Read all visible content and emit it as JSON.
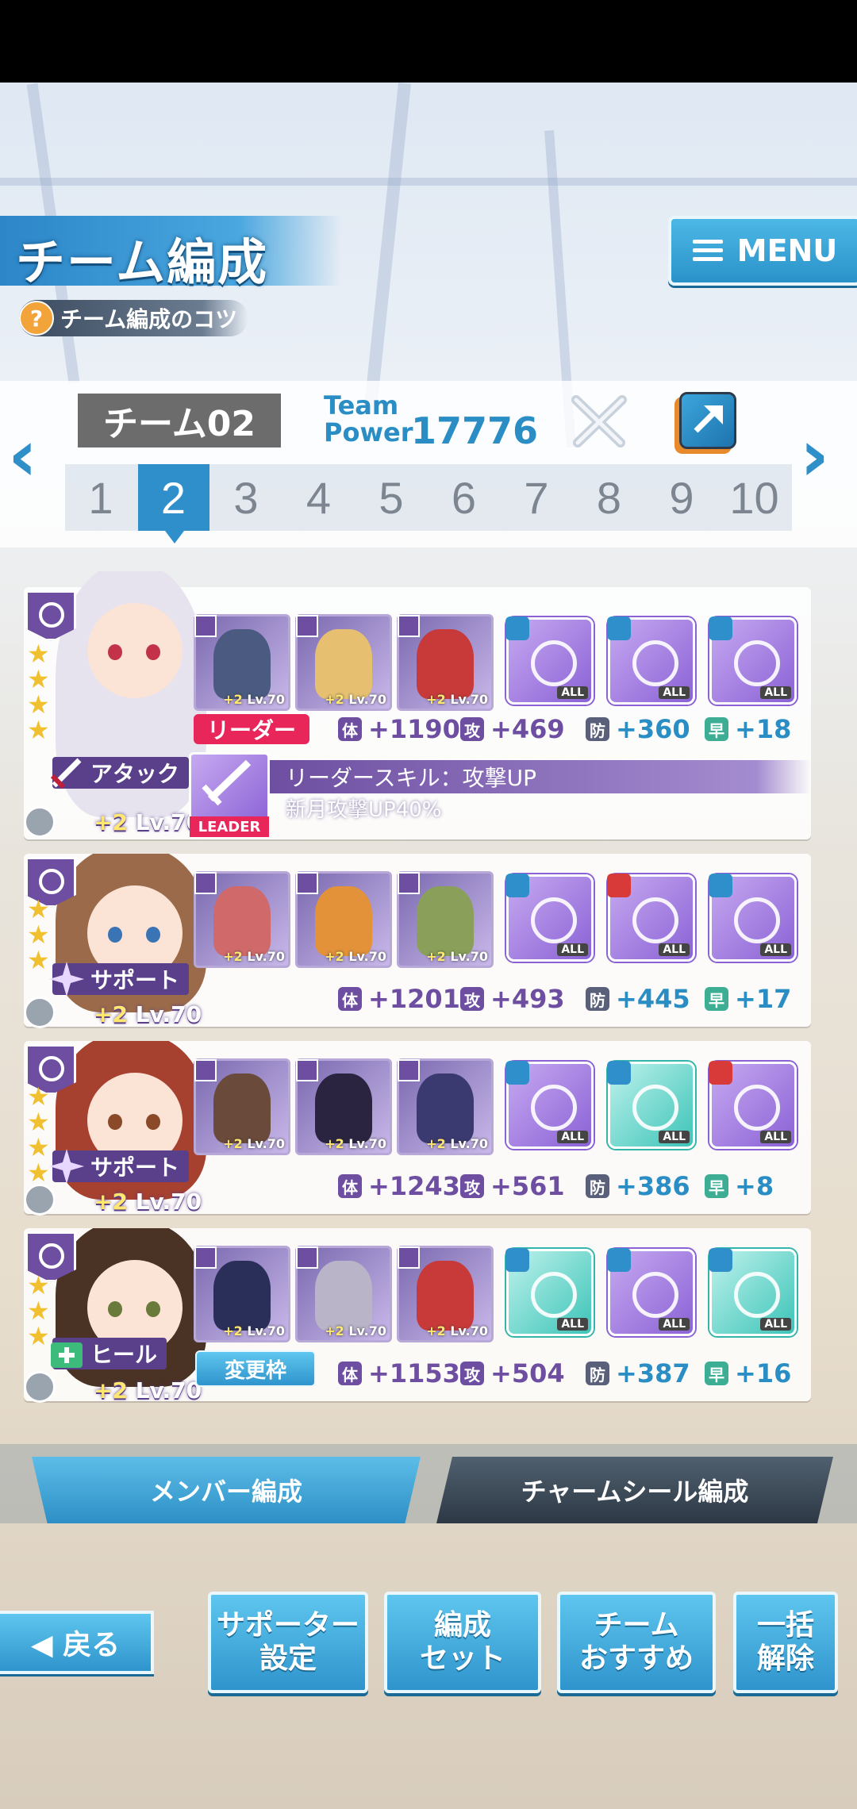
{
  "header": {
    "title": "チーム編成",
    "tips": "チーム編成のコツ",
    "menu_label": "MENU"
  },
  "team": {
    "name": "チーム02",
    "power_label_1": "Team",
    "power_label_2": "Power",
    "power_value": "17776",
    "numbers": [
      "1",
      "2",
      "3",
      "4",
      "5",
      "6",
      "7",
      "8",
      "9",
      "10"
    ],
    "active_index": 1
  },
  "members": [
    {
      "role": "アタック",
      "level": "Lv.70",
      "plus": "+2",
      "leader_badge": "リーダー",
      "leader_icon_label": "LEADER",
      "leader_skill_title": "リーダースキル：攻撃UP",
      "leader_skill_desc": "新月攻撃UP40%",
      "cards": [
        {
          "plus": "+2",
          "level": "Lv.70"
        },
        {
          "plus": "+2",
          "level": "Lv.70"
        },
        {
          "plus": "+2",
          "level": "Lv.70"
        }
      ],
      "seals": [
        {
          "label": "ALL"
        },
        {
          "label": "ALL"
        },
        {
          "label": "ALL"
        }
      ],
      "stats": {
        "hp_key": "体",
        "hp": "+1190",
        "atk_key": "攻",
        "atk": "+469",
        "def_key": "防",
        "def": "+360",
        "spd_key": "早",
        "spd": "+18"
      }
    },
    {
      "role": "サポート",
      "level": "Lv.70",
      "plus": "+2",
      "cards": [
        {
          "plus": "+2",
          "level": "Lv.70"
        },
        {
          "plus": "+2",
          "level": "Lv.70"
        },
        {
          "plus": "+2",
          "level": "Lv.70"
        }
      ],
      "seals": [
        {
          "label": "ALL"
        },
        {
          "label": "ALL"
        },
        {
          "label": "ALL"
        }
      ],
      "stats": {
        "hp_key": "体",
        "hp": "+1201",
        "atk_key": "攻",
        "atk": "+493",
        "def_key": "防",
        "def": "+445",
        "spd_key": "早",
        "spd": "+17"
      }
    },
    {
      "role": "サポート",
      "level": "Lv.70",
      "plus": "+2",
      "cards": [
        {
          "plus": "+2",
          "level": "Lv.70"
        },
        {
          "plus": "+2",
          "level": "Lv.70"
        },
        {
          "plus": "+2",
          "level": "Lv.70"
        }
      ],
      "seals": [
        {
          "label": "ALL"
        },
        {
          "label": "ALL"
        },
        {
          "label": "ALL"
        }
      ],
      "stats": {
        "hp_key": "体",
        "hp": "+1243",
        "atk_key": "攻",
        "atk": "+561",
        "def_key": "防",
        "def": "+386",
        "spd_key": "早",
        "spd": "+8"
      }
    },
    {
      "role": "ヒール",
      "level": "Lv.70",
      "plus": "+2",
      "change_button": "変更枠",
      "cards": [
        {
          "plus": "+2",
          "level": "Lv.70"
        },
        {
          "plus": "+2",
          "level": "Lv.70"
        },
        {
          "plus": "+2",
          "level": "Lv.70"
        }
      ],
      "seals": [
        {
          "label": "ALL"
        },
        {
          "label": "ALL"
        },
        {
          "label": "ALL"
        }
      ],
      "stats": {
        "hp_key": "体",
        "hp": "+1153",
        "atk_key": "攻",
        "atk": "+504",
        "def_key": "防",
        "def": "+387",
        "spd_key": "早",
        "spd": "+16"
      }
    }
  ],
  "tabs": {
    "members": "メンバー編成",
    "seals": "チャームシール編成"
  },
  "bottom": {
    "back": "◀ 戻る",
    "supporter_1": "サポーター",
    "supporter_2": "設定",
    "set_1": "編成",
    "set_2": "セット",
    "recommend_1": "チーム",
    "recommend_2": "おすすめ",
    "clear_1": "一括",
    "clear_2": "解除"
  },
  "colors": {
    "accent": "#2f8fcb",
    "purple": "#6d4ea0",
    "leader_red": "#e8265a"
  }
}
